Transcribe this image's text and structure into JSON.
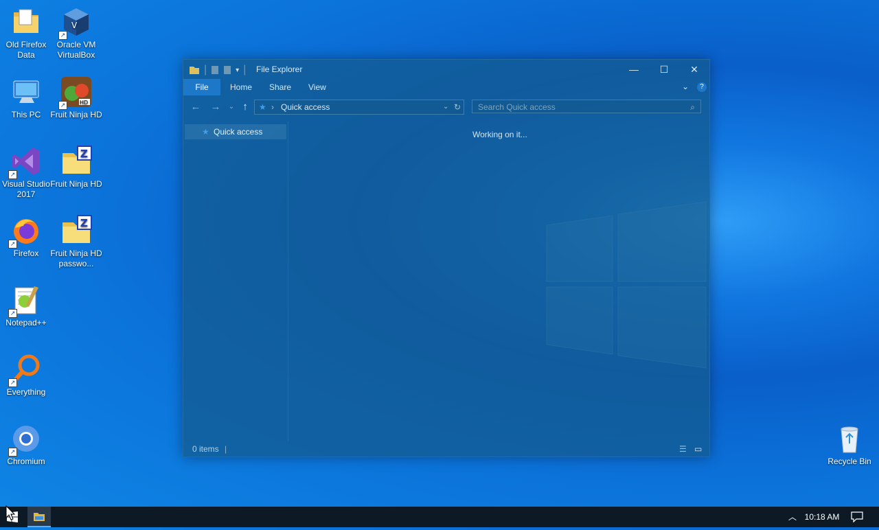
{
  "desktop": {
    "icons": [
      {
        "label": "Old Firefox Data",
        "icon": "folder-icon"
      },
      {
        "label": "Oracle VM VirtualBox",
        "icon": "virtualbox-icon"
      },
      {
        "label": "This PC",
        "icon": "computer-icon"
      },
      {
        "label": "Fruit Ninja HD",
        "icon": "fruit-ninja-icon"
      },
      {
        "label": "Visual Studio 2017",
        "icon": "visual-studio-icon"
      },
      {
        "label": "Fruit Ninja HD",
        "icon": "zip-folder-icon"
      },
      {
        "label": "Firefox",
        "icon": "firefox-icon"
      },
      {
        "label": "Fruit Ninja HD passwo...",
        "icon": "zip-folder-icon"
      },
      {
        "label": "Notepad++",
        "icon": "notepadpp-icon"
      },
      {
        "label": "Everything",
        "icon": "everything-search-icon"
      },
      {
        "label": "Chromium",
        "icon": "chromium-icon"
      },
      {
        "label": "Recycle Bin",
        "icon": "recycle-bin-icon"
      }
    ]
  },
  "explorer": {
    "title": "File Explorer",
    "tabs": [
      "File",
      "Home",
      "Share",
      "View"
    ],
    "address": "Quick access",
    "search_placeholder": "Search Quick access",
    "nav_items": [
      "Quick access"
    ],
    "loading_text": "Working on it...",
    "status_text": "0 items"
  },
  "taskbar": {
    "clock": "10:18 AM"
  },
  "colors": {
    "accent": "#1d78c9",
    "taskbar": "#0d1a26"
  }
}
